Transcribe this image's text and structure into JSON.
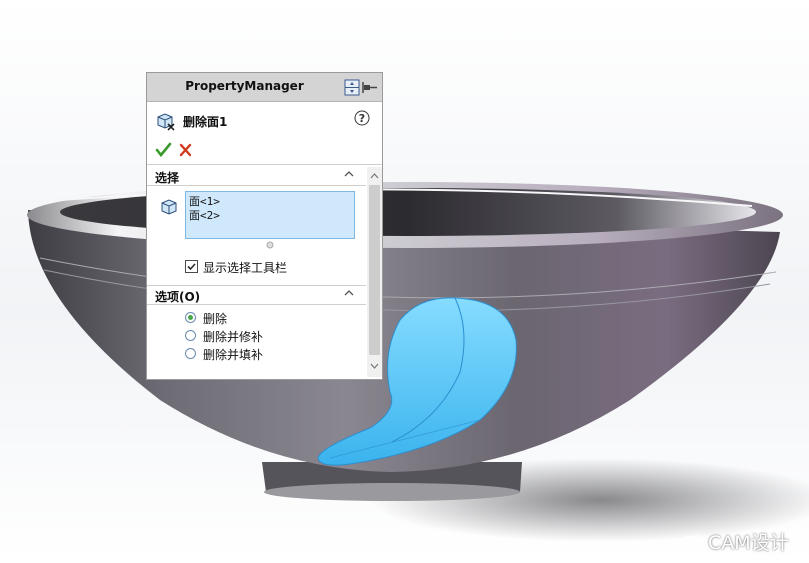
{
  "panel": {
    "title": "PropertyManager",
    "feature_name": "删除面1",
    "help": "?"
  },
  "selection": {
    "header": "选择",
    "faces": [
      "面<1>",
      "面<2>"
    ],
    "show_toolbar_label": "显示选择工具栏",
    "show_toolbar_checked": true
  },
  "options": {
    "header": "选项(O)",
    "items": [
      {
        "label": "删除",
        "selected": true
      },
      {
        "label": "删除并修补",
        "selected": false
      },
      {
        "label": "删除并填补",
        "selected": false
      }
    ]
  },
  "watermark": "CAM设计",
  "colors": {
    "accept": "#3a9a2c",
    "cancel": "#d23a1e",
    "selected_face": "#5ec8f5",
    "selection_box": "#cfe8fb"
  }
}
